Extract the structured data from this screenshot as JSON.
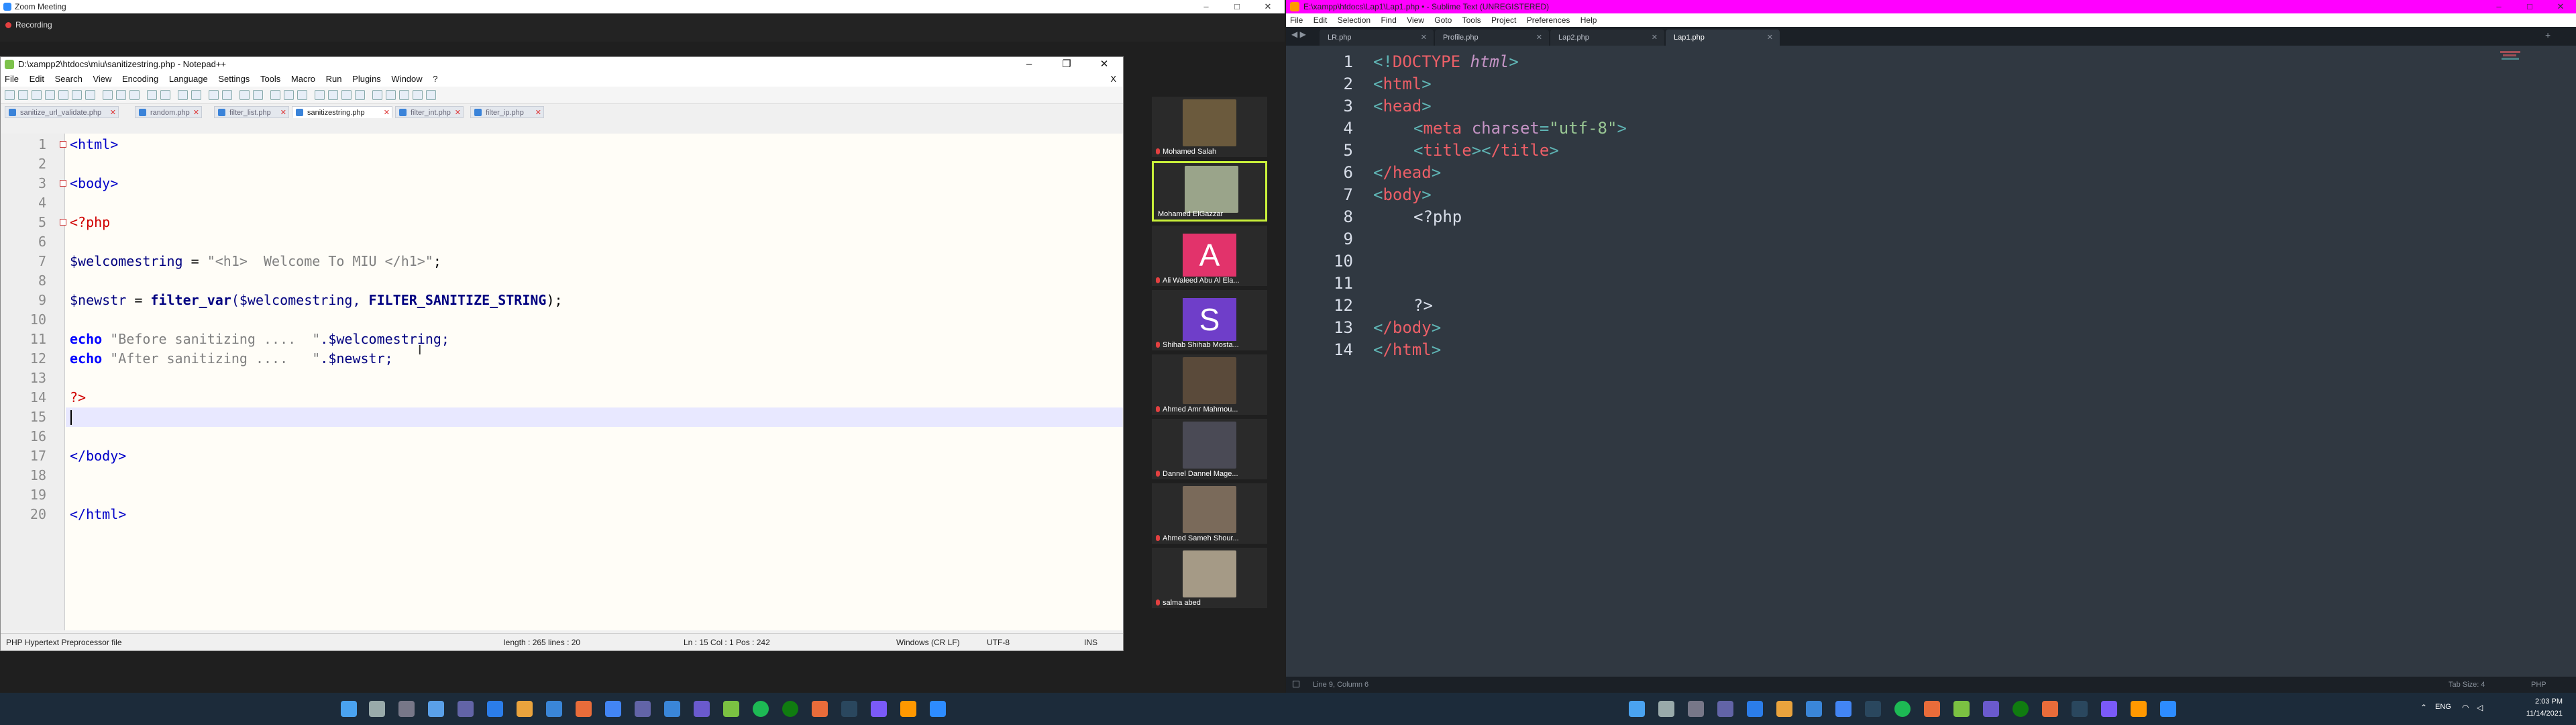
{
  "zoom": {
    "title": "Zoom Meeting",
    "recording_label": "Recording"
  },
  "notepad": {
    "title": "D:\\xampp2\\htdocs\\miu\\sanitizestring.php - Notepad++",
    "close_label": "X",
    "menu": [
      "File",
      "Edit",
      "Search",
      "View",
      "Encoding",
      "Language",
      "Settings",
      "Tools",
      "Macro",
      "Run",
      "Plugins",
      "Window",
      "?"
    ],
    "tabs": [
      {
        "label": "sanitize_url_validate.php"
      },
      {
        "label": "random.php"
      },
      {
        "label": "filter_list.php"
      },
      {
        "label": "sanitizestring.php"
      },
      {
        "label": "filter_int.php"
      },
      {
        "label": "filter_ip.php"
      }
    ],
    "active_tab_index": 3,
    "line_numbers": [
      "1",
      "2",
      "3",
      "4",
      "5",
      "6",
      "7",
      "8",
      "9",
      "10",
      "11",
      "12",
      "13",
      "14",
      "15",
      "16",
      "17",
      "18",
      "19",
      "20"
    ],
    "code": {
      "l1": "<html>",
      "l3": "<body>",
      "l5": "<?php",
      "l7_var": "$welcomestring",
      "l7_eq": " = ",
      "l7_str": "\"<h1>  Welcome To MIU </h1>\"",
      "l7_end": ";",
      "l9_var": "$newstr",
      "l9_eq": " = ",
      "l9_fn": "filter_var",
      "l9_args": "($welcomestring, ",
      "l9_const": "FILTER_SANITIZE_STRING",
      "l9_end": ");",
      "l11_kw": "echo",
      "l11_str": " \"Before sanitizing ....  \"",
      "l11_rest": ".$welcomestring;",
      "l12_kw": "echo",
      "l12_str": " \"After sanitizing ....   \"",
      "l12_rest": ".$newstr;",
      "l14": "?>",
      "l17": "</body>",
      "l20": "</html>"
    },
    "status": {
      "filetype": "PHP Hypertext Preprocessor file",
      "length": "length : 265    lines : 20",
      "position": "Ln : 15    Col : 1    Pos : 242",
      "eol": "Windows (CR LF)",
      "encoding": "UTF-8",
      "mode": "INS"
    }
  },
  "participants": [
    {
      "name": "Mohamed Salah",
      "color": "#6b5a3d"
    },
    {
      "name": "Mohamed ElGazzar",
      "color": "#9aa48a"
    },
    {
      "name": "Ali Waleed Abu Al Ela...",
      "letter": "A",
      "color": "#e2336b"
    },
    {
      "name": "Shihab Shihab Mosta...",
      "letter": "S",
      "color": "#6f3ec9"
    },
    {
      "name": "Ahmed Amr Mahmou...",
      "color": "#5a4a3a"
    },
    {
      "name": "Dannel Dannel Mage...",
      "color": "#4a4a55"
    },
    {
      "name": "Ahmed Sameh Shour...",
      "color": "#7a6a5a"
    },
    {
      "name": "salma abed",
      "color": "#a59a86"
    }
  ],
  "sublime": {
    "title": "E:\\xampp\\htdocs\\Lap1\\Lap1.php • - Sublime Text (UNREGISTERED)",
    "menu": [
      "File",
      "Edit",
      "Selection",
      "Find",
      "View",
      "Goto",
      "Tools",
      "Project",
      "Preferences",
      "Help"
    ],
    "tabs": [
      {
        "label": "LR.php"
      },
      {
        "label": "Profile.php"
      },
      {
        "label": "Lap2.php"
      },
      {
        "label": "Lap1.php"
      }
    ],
    "active_tab_index": 3,
    "line_numbers": [
      "1",
      "2",
      "3",
      "4",
      "5",
      "6",
      "7",
      "8",
      "9",
      "10",
      "11",
      "12",
      "13",
      "14"
    ],
    "code": {
      "l1a": "<!",
      "l1b": "DOCTYPE",
      "l1c": " html",
      "l1d": ">",
      "l2": "html",
      "l3": "head",
      "l4_tag": "meta",
      "l4_attr": " charset",
      "l4_eq": "=",
      "l4_val": "\"utf-8\"",
      "l5_tag": "title",
      "l5_close": "/title",
      "l6": "/head",
      "l7": "body",
      "l8": "<?php",
      "l12": "?>",
      "l13": "/body",
      "l14": "/html"
    },
    "status": {
      "position": "Line 9, Column 6",
      "tab_size": "Tab Size: 4",
      "syntax": "PHP"
    }
  },
  "taskbar": {
    "language": "ENG",
    "time": "2:03 PM",
    "date": "11/14/2021"
  }
}
